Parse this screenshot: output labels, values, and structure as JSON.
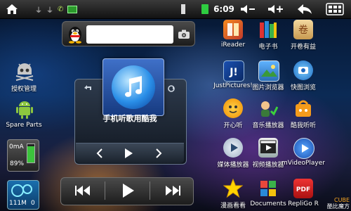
{
  "status_bar": {
    "time": "6:09",
    "notification_icons": [
      "usb-icon",
      "usb-icon",
      "phone-icon",
      "apk-icon"
    ],
    "battery_color": "#2ecc40"
  },
  "search_widget": {
    "placeholder": ""
  },
  "left_dock": [
    {
      "label": "授权管理",
      "icon": "android-skull-icon"
    },
    {
      "label": "Spare Parts",
      "icon": "android-robot-icon"
    },
    {
      "label": "0mA",
      "sublabel": "89%",
      "icon": "battery-monitor-icon",
      "level_percent": 89
    },
    {
      "label": "111M",
      "sublabel": "0",
      "icon": "memory-monitor-icon"
    }
  ],
  "music_widget": {
    "song_title": "手机听歌用酷我"
  },
  "apps": [
    {
      "label": "iReader",
      "icon": "ireader-icon"
    },
    {
      "label": "电子书",
      "icon": "ebook-icon"
    },
    {
      "label": "开卷有益",
      "icon": "scroll-icon"
    },
    {
      "label": "JustPictures!",
      "icon": "just-pictures-icon"
    },
    {
      "label": "图片浏览器",
      "icon": "image-browser-icon"
    },
    {
      "label": "快图浏览",
      "icon": "quickpic-icon"
    },
    {
      "label": "开心听",
      "icon": "kaixinting-icon"
    },
    {
      "label": "音乐播放器",
      "icon": "music-player-icon"
    },
    {
      "label": "酷我听听",
      "icon": "kuwo-icon"
    },
    {
      "label": "媒体播放器",
      "icon": "media-player-icon"
    },
    {
      "label": "视频播放器",
      "icon": "video-player-icon"
    },
    {
      "label": "mVideoPlayer",
      "icon": "mvideoplayer-icon"
    },
    {
      "label": "漫画看看",
      "icon": "comic-icon"
    },
    {
      "label": "Documents",
      "icon": "documents-icon"
    },
    {
      "label": "RepliGo R",
      "icon": "repligo-icon"
    }
  ],
  "watermark": {
    "line1": "CUBE",
    "line2": "酷比魔方"
  }
}
